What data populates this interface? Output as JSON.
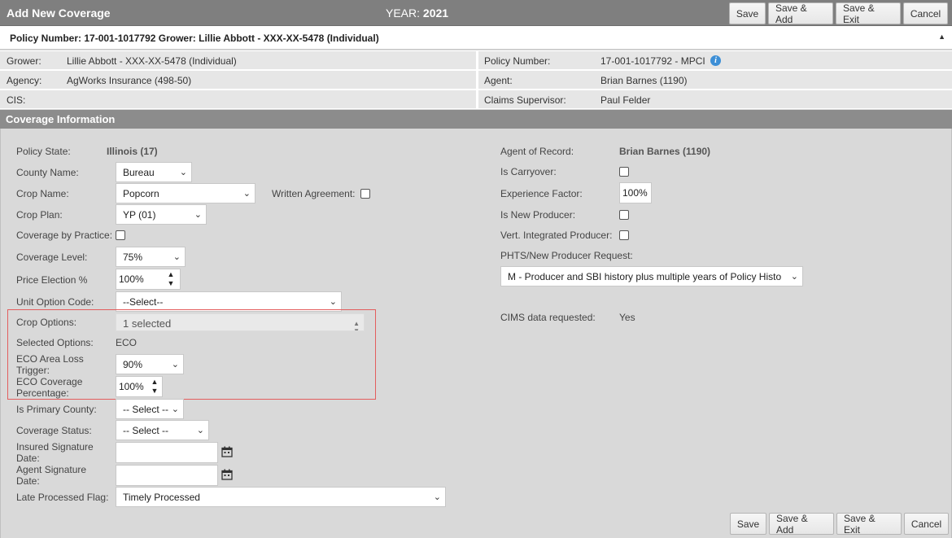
{
  "header": {
    "title": "Add New Coverage",
    "year_label": "YEAR:",
    "year_value": "2021",
    "buttons": {
      "save": "Save",
      "save_add": "Save & Add",
      "save_exit": "Save & Exit",
      "cancel": "Cancel"
    }
  },
  "policy_bar": {
    "text": "Policy Number: 17-001-1017792 Grower: Lillie Abbott - XXX-XX-5478 (Individual)",
    "caret": "▲"
  },
  "info": {
    "grower_label": "Grower:",
    "grower_value": "Lillie Abbott - XXX-XX-5478 (Individual)",
    "agency_label": "Agency:",
    "agency_value": "AgWorks Insurance (498-50)",
    "cis_label": "CIS:",
    "policy_number_label": "Policy Number:",
    "policy_number_value": "17-001-1017792 - MPCI",
    "agent_label": "Agent:",
    "agent_value": "Brian Barnes (1190)",
    "claims_supervisor_label": "Claims Supervisor:",
    "claims_supervisor_value": "Paul Felder"
  },
  "section": {
    "title": "Coverage Information"
  },
  "form": {
    "policy_state_label": "Policy State:",
    "policy_state_value": "Illinois (17)",
    "county_name_label": "County Name:",
    "county_name_value": "Bureau",
    "crop_name_label": "Crop Name:",
    "crop_name_value": "Popcorn",
    "written_agreement_label": "Written Agreement:",
    "crop_plan_label": "Crop Plan:",
    "crop_plan_value": "YP (01)",
    "coverage_by_practice_label": "Coverage by Practice:",
    "coverage_level_label": "Coverage Level:",
    "coverage_level_value": "75%",
    "price_election_label": "Price Election %",
    "price_election_value": "100%",
    "unit_option_code_label": "Unit Option Code:",
    "unit_option_code_value": "--Select--",
    "crop_options_label": "Crop Options:",
    "crop_options_value": "1 selected",
    "selected_options_label": "Selected Options:",
    "selected_options_value": "ECO",
    "eco_area_loss_trigger_label_1": "ECO Area Loss",
    "eco_area_loss_trigger_label_2": "Trigger:",
    "eco_area_loss_trigger_value": "90%",
    "eco_coverage_percentage_label_1": "ECO Coverage",
    "eco_coverage_percentage_label_2": "Percentage:",
    "eco_coverage_percentage_value": "100%",
    "is_primary_county_label": "Is Primary County:",
    "is_primary_county_value": "-- Select --",
    "coverage_status_label": "Coverage Status:",
    "coverage_status_value": "-- Select --",
    "insured_signature_date_label_1": "Insured Signature",
    "insured_signature_date_label_2": "Date:",
    "agent_signature_date_label_1": "Agent Signature",
    "agent_signature_date_label_2": "Date:",
    "late_processed_flag_label": "Late Processed Flag:",
    "late_processed_flag_value": "Timely Processed",
    "agent_of_record_label": "Agent of Record:",
    "agent_of_record_value": "Brian Barnes (1190)",
    "is_carryover_label": "Is Carryover:",
    "experience_factor_label": "Experience Factor:",
    "experience_factor_value": "100%",
    "is_new_producer_label": "Is New Producer:",
    "vert_integrated_producer_label": "Vert. Integrated Producer:",
    "phts_label": "PHTS/New Producer Request:",
    "phts_value": "M - Producer and SBI history plus multiple years of Policy History",
    "cims_label": "CIMS data requested:",
    "cims_value": "Yes"
  },
  "footer": {
    "buttons": {
      "save": "Save",
      "save_add": "Save & Add",
      "save_exit": "Save & Exit",
      "cancel": "Cancel"
    }
  },
  "colors": {
    "header_bg": "#7f7f7f",
    "section_bg": "#8c8c8c",
    "form_bg": "#d9d9d9",
    "highlight_border": "#e35e5e",
    "info_icon": "#3d8fd6"
  }
}
